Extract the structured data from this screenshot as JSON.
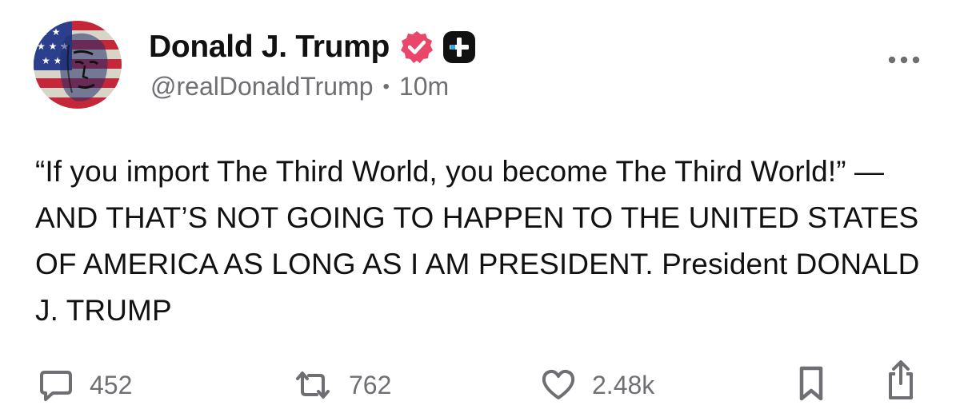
{
  "author": {
    "display_name": "Donald J. Trump",
    "handle": "@realDonaldTrump",
    "separator": "•",
    "time_ago": "10m",
    "avatar": "flag-portrait-avatar",
    "verified_icon": "verified-badge-icon",
    "plus_icon": "plus-badge-icon"
  },
  "post": {
    "text": "“If you import The Third World, you become The Third World!” — AND THAT’S NOT GOING TO HAPPEN TO THE UNITED STATES OF AMERICA AS LONG AS I AM PRESIDENT. President DONALD J. TRUMP"
  },
  "actions": {
    "replies": "452",
    "reposts": "762",
    "likes": "2.48k"
  },
  "icons": {
    "reply": "speech-bubble-icon",
    "repost": "repost-arrows-icon",
    "like": "heart-icon",
    "bookmark": "bookmark-icon",
    "share": "share-icon",
    "more": "more-options-icon"
  },
  "colors": {
    "text": "#111111",
    "secondary": "#6f6f73",
    "verified": "#e8476a",
    "badge": "#111111"
  }
}
